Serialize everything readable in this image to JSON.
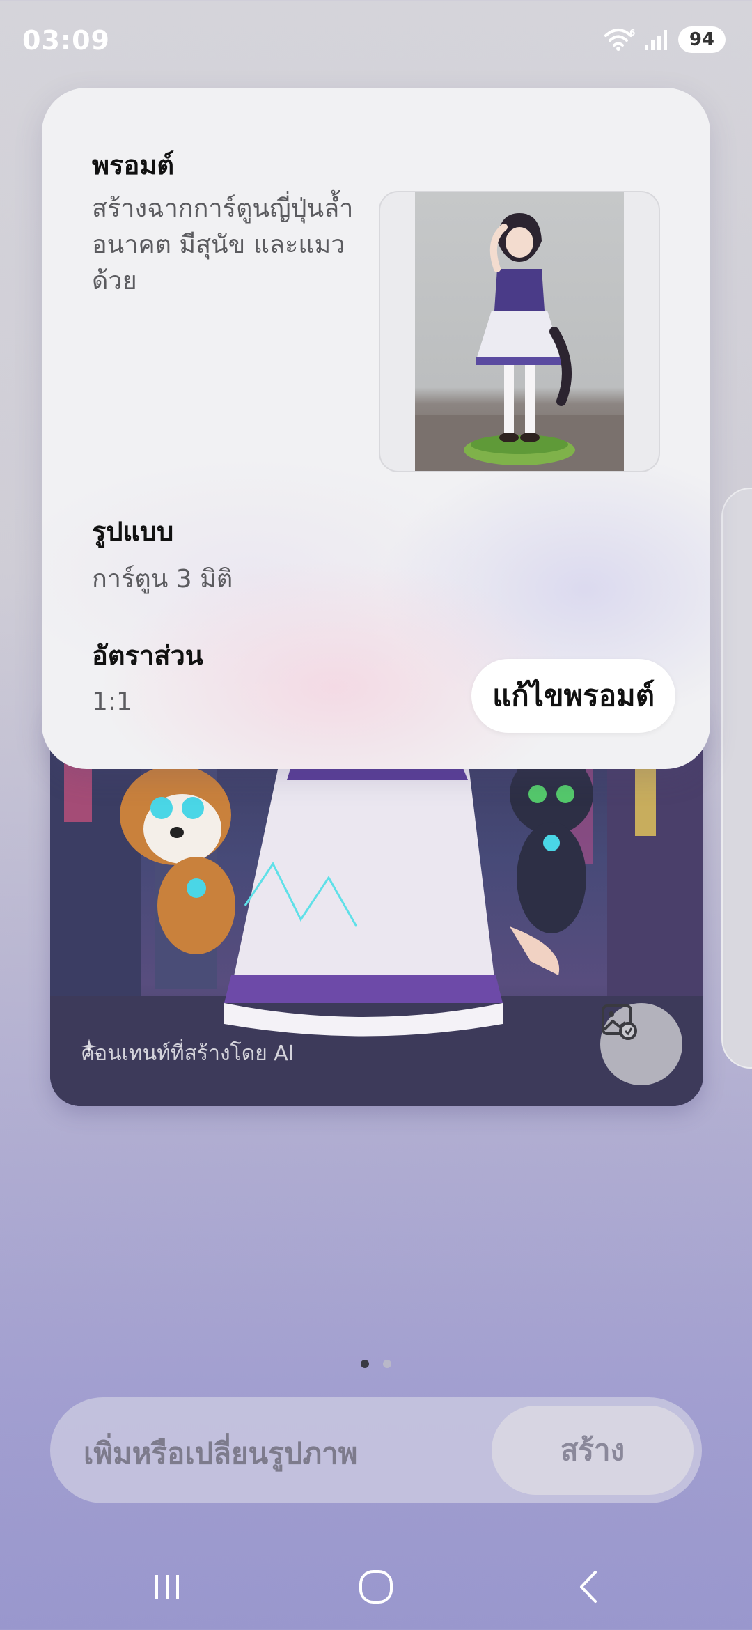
{
  "status_bar": {
    "time": "03:09",
    "wifi_badge": "6",
    "battery": "94",
    "icons": [
      "wifi-icon",
      "signal-icon"
    ]
  },
  "prompt_card": {
    "prompt_label": "พรอมต์",
    "prompt_text": "สร้างฉากการ์ตูนญี่ปุ่นล้ำอนาคต มีสุนัข และแมวด้วย",
    "style_label": "รูปแบบ",
    "style_value": "การ์ตูน 3 มิติ",
    "ratio_label": "อัตราส่วน",
    "ratio_value": "1:1",
    "edit_button": "แก้ไขพรอมต์"
  },
  "artwork": {
    "ai_label": "คอนเทนท์ที่สร้างโดย AI",
    "icons": [
      "sparkle-icon",
      "image-edit-icon"
    ]
  },
  "pager": {
    "count": 2,
    "active_index": 0
  },
  "input_bar": {
    "placeholder": "เพิ่มหรือเปลี่ยนรูปภาพ",
    "create_button": "สร้าง"
  },
  "nav": {
    "icons": [
      "recent-apps-icon",
      "home-icon",
      "back-icon"
    ]
  },
  "colors": {
    "background_top": "#d5d4da",
    "background_bottom": "#9997cd",
    "card": "#f1f1f3",
    "text_primary": "#111111",
    "text_secondary": "#5b5b5f"
  }
}
